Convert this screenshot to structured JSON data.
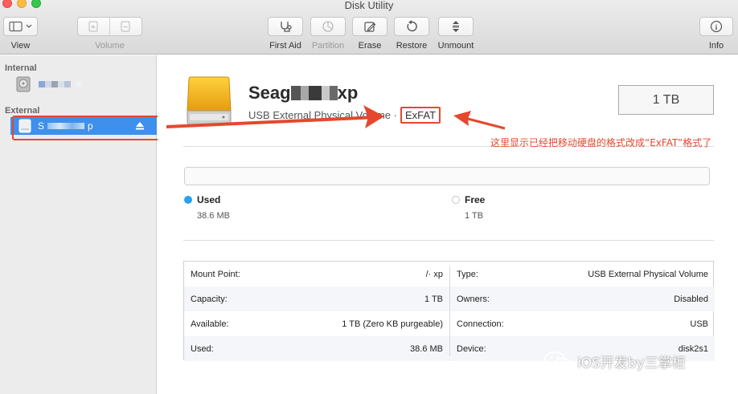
{
  "window": {
    "title": "Disk Utility"
  },
  "toolbar": {
    "view_label": "View",
    "volume_label": "Volume",
    "first_aid_label": "First Aid",
    "partition_label": "Partition",
    "erase_label": "Erase",
    "restore_label": "Restore",
    "unmount_label": "Unmount",
    "info_label": "Info",
    "info_glyph": "i"
  },
  "sidebar": {
    "internal_header": "Internal",
    "external_header": "External",
    "external_item_prefix": "S",
    "external_item_suffix": "p"
  },
  "disk": {
    "name_prefix": "Seag",
    "name_suffix": "xp",
    "subtitle": "USB External Physical Volume ·",
    "filesystem": "ExFAT",
    "capacity": "1 TB"
  },
  "usage": {
    "used_label": "Used",
    "used_value": "38.6 MB",
    "free_label": "Free",
    "free_value": "1 TB",
    "used_fraction": 4e-05,
    "used_color": "#2ba0f0"
  },
  "info": {
    "left": [
      {
        "label": "Mount Point:",
        "value": "/·        xp"
      },
      {
        "label": "Capacity:",
        "value": "1 TB"
      },
      {
        "label": "Available:",
        "value": "1 TB (Zero KB purgeable)"
      },
      {
        "label": "Used:",
        "value": "38.6 MB"
      }
    ],
    "right": [
      {
        "label": "Type:",
        "value": "USB External Physical Volume"
      },
      {
        "label": "Owners:",
        "value": "Disabled"
      },
      {
        "label": "Connection:",
        "value": "USB"
      },
      {
        "label": "Device:",
        "value": "disk2s1"
      }
    ]
  },
  "annotation": {
    "text": "这里显示已经把移动硬盘的格式改成“ExFAT”格式了",
    "color": "#e5482f"
  },
  "watermark": {
    "text": "iOS开发by三掌柜"
  }
}
